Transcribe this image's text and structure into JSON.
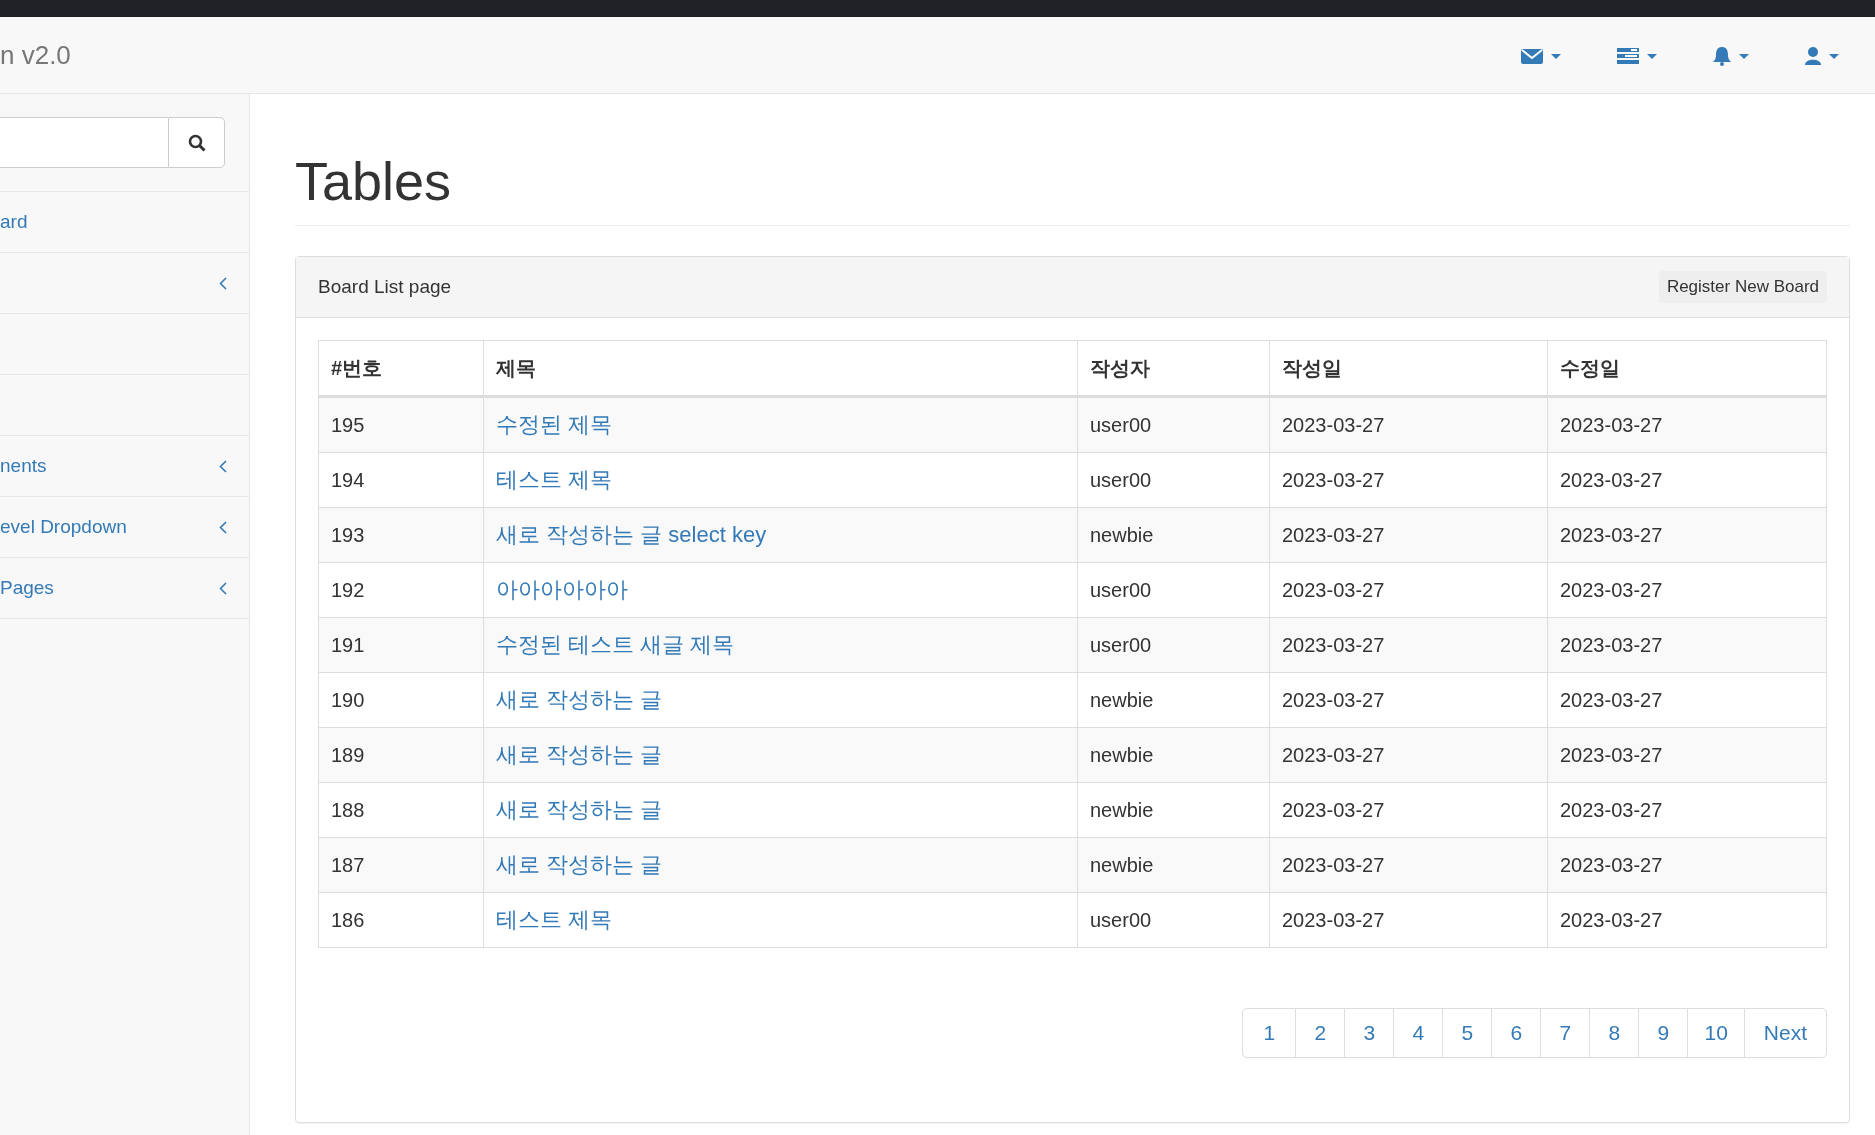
{
  "navbar": {
    "brand": "n v2.0"
  },
  "sidebar": {
    "items": [
      {
        "kind": "link",
        "label": "ard"
      },
      {
        "kind": "submenu"
      },
      {
        "kind": "link"
      },
      {
        "kind": "link"
      },
      {
        "kind": "submenu",
        "label": "nents"
      },
      {
        "kind": "submenu",
        "label": "evel Dropdown"
      },
      {
        "kind": "submenu",
        "label": "Pages"
      }
    ]
  },
  "page": {
    "title": "Tables"
  },
  "panel": {
    "heading": "Board List page",
    "button": "Register New Board",
    "table": {
      "columns": [
        "#번호",
        "제목",
        "작성자",
        "작성일",
        "수정일"
      ],
      "rows": [
        [
          "195",
          "수정된 제목",
          "user00",
          "2023-03-27",
          "2023-03-27"
        ],
        [
          "194",
          "테스트 제목",
          "user00",
          "2023-03-27",
          "2023-03-27"
        ],
        [
          "193",
          "새로 작성하는 글 select key",
          "newbie",
          "2023-03-27",
          "2023-03-27"
        ],
        [
          "192",
          "아아아아아아",
          "user00",
          "2023-03-27",
          "2023-03-27"
        ],
        [
          "191",
          "수정된 테스트 새글 제목",
          "user00",
          "2023-03-27",
          "2023-03-27"
        ],
        [
          "190",
          "새로 작성하는 글",
          "newbie",
          "2023-03-27",
          "2023-03-27"
        ],
        [
          "189",
          "새로 작성하는 글",
          "newbie",
          "2023-03-27",
          "2023-03-27"
        ],
        [
          "188",
          "새로 작성하는 글",
          "newbie",
          "2023-03-27",
          "2023-03-27"
        ],
        [
          "187",
          "새로 작성하는 글",
          "newbie",
          "2023-03-27",
          "2023-03-27"
        ],
        [
          "186",
          "테스트 제목",
          "user00",
          "2023-03-27",
          "2023-03-27"
        ]
      ]
    },
    "pagination": [
      "1",
      "2",
      "3",
      "4",
      "5",
      "6",
      "7",
      "8",
      "9",
      "10",
      "Next"
    ]
  }
}
